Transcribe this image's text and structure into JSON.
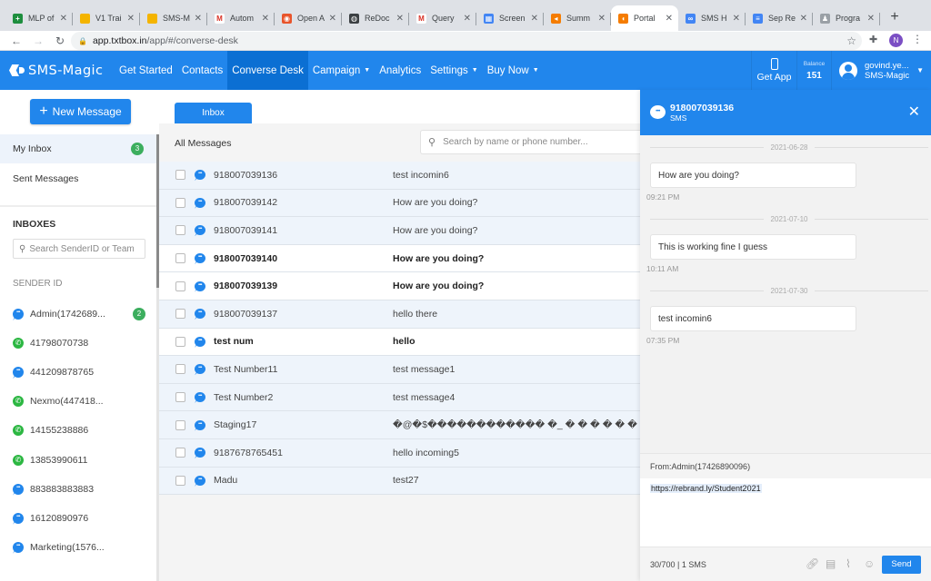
{
  "browser": {
    "tabs": [
      {
        "label": "MLP of",
        "color": "#1e8e3e",
        "glyph": "+"
      },
      {
        "label": "V1 Trai",
        "color": "#f4b400",
        "glyph": ""
      },
      {
        "label": "SMS-M",
        "color": "#f4b400",
        "glyph": ""
      },
      {
        "label": "Autom",
        "color": "#ffffff",
        "glyph": "M"
      },
      {
        "label": "Open A",
        "color": "#e8542b",
        "glyph": "◉"
      },
      {
        "label": "ReDoc",
        "color": "#3c4043",
        "glyph": "◍"
      },
      {
        "label": "Query",
        "color": "#ffffff",
        "glyph": "M"
      },
      {
        "label": "Screen",
        "color": "#4285f4",
        "glyph": "▦"
      },
      {
        "label": "Summ",
        "color": "#f57c00",
        "glyph": "◂"
      },
      {
        "label": "Portal",
        "color": "#f57c00",
        "glyph": "◖",
        "active": true
      },
      {
        "label": "SMS H",
        "color": "#4285f4",
        "glyph": "∞"
      },
      {
        "label": "Sep Re",
        "color": "#4285f4",
        "glyph": "≡"
      },
      {
        "label": "Progra",
        "color": "#9aa0a6",
        "glyph": "♟"
      }
    ],
    "new_tab": "+",
    "url_host": "app.txtbox.in",
    "url_path": "/app/#/converse-desk",
    "profile_initial": "N"
  },
  "nav": {
    "brand": "SMS-Magic",
    "items": [
      {
        "label": "Get Started",
        "dropdown": false,
        "active": false
      },
      {
        "label": "Contacts",
        "dropdown": false,
        "active": false
      },
      {
        "label": "Converse Desk",
        "dropdown": false,
        "active": true
      },
      {
        "label": "Campaign",
        "dropdown": true,
        "active": false
      },
      {
        "label": "Analytics",
        "dropdown": false,
        "active": false
      },
      {
        "label": "Settings",
        "dropdown": true,
        "active": false
      },
      {
        "label": "Buy Now",
        "dropdown": true,
        "active": false
      }
    ],
    "get_app": "Get App",
    "balance_label": "Balance",
    "balance_value": "151",
    "user_name": "govind.ye...",
    "user_company": "SMS-Magic"
  },
  "sidebar": {
    "new_message": "New Message",
    "my_inbox": "My Inbox",
    "my_inbox_count": "3",
    "sent_messages": "Sent Messages",
    "inboxes_heading": "INBOXES",
    "search_placeholder": "Search SenderID or Team",
    "sender_id_heading": "SENDER ID",
    "senders": [
      {
        "label": "Admin(1742689...",
        "type": "sms",
        "count": "2"
      },
      {
        "label": "41798070738",
        "type": "whatsapp"
      },
      {
        "label": "441209878765",
        "type": "sms"
      },
      {
        "label": "Nexmo(447418...",
        "type": "whatsapp"
      },
      {
        "label": "14155238886",
        "type": "whatsapp"
      },
      {
        "label": "13853990611",
        "type": "whatsapp"
      },
      {
        "label": "883883883883",
        "type": "sms"
      },
      {
        "label": "16120890976",
        "type": "sms"
      },
      {
        "label": "Marketing(1576...",
        "type": "sms"
      }
    ]
  },
  "main": {
    "tab_inbox": "Inbox",
    "list_title": "All Messages",
    "search_placeholder": "Search by name or phone number...",
    "rows": [
      {
        "name": "918007039136",
        "message": "test incomin6",
        "unread": false
      },
      {
        "name": "918007039142",
        "message": "How are you doing?",
        "unread": false
      },
      {
        "name": "918007039141",
        "message": "How are you doing?",
        "unread": false
      },
      {
        "name": "918007039140",
        "message": "How are you doing?",
        "unread": true
      },
      {
        "name": "918007039139",
        "message": "How are you doing?",
        "unread": true
      },
      {
        "name": "918007039137",
        "message": "hello there",
        "unread": false
      },
      {
        "name": "test num",
        "message": "hello",
        "unread": true
      },
      {
        "name": "Test Number11",
        "message": "test message1",
        "unread": false
      },
      {
        "name": "Test Number2",
        "message": "test message4",
        "unread": false
      },
      {
        "name": "Staging17",
        "message": "�@�$������������ �_ � � � � � � � � � �",
        "unread": false
      },
      {
        "name": "9187678765451",
        "message": "hello incoming5",
        "unread": false
      },
      {
        "name": "Madu",
        "message": "test27",
        "unread": false
      }
    ]
  },
  "conversation": {
    "number": "918007039136",
    "channel": "SMS",
    "messages": [
      {
        "date": "2021-06-28",
        "text": "How are you doing?",
        "time": "09:21 PM"
      },
      {
        "date": "2021-07-10",
        "text": "This is working fine I guess",
        "time": "10:11 AM"
      },
      {
        "date": "2021-07-30",
        "text": "test incomin6",
        "time": "07:35 PM"
      }
    ],
    "from": "From:Admin(17426890096)",
    "compose_text": "https://rebrand.ly/Student2021",
    "char_count": "30/700 | 1 SMS",
    "send": "Send"
  },
  "colors": {
    "primary": "#2186ec",
    "active_nav": "#0b6fd3",
    "badge": "#3cae5e",
    "whatsapp": "#2cb742"
  }
}
